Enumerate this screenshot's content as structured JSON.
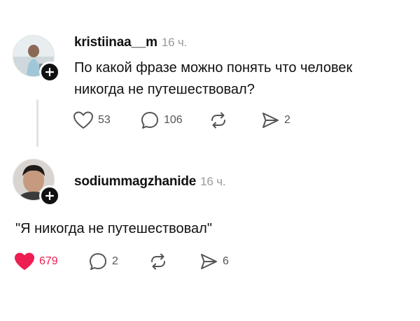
{
  "posts": [
    {
      "username": "kristiinaa__m",
      "time": "16 ч.",
      "text_lines": [
        "По какой фразе можно понять что человек",
        "никогда не путешествовал?"
      ],
      "likes": "53",
      "liked": false,
      "comments": "106",
      "shares": "2"
    },
    {
      "username": "sodiummagzhanide",
      "time": "16 ч.",
      "text_lines": [
        "\"Я никогда не путешествовал\""
      ],
      "likes": "679",
      "liked": true,
      "comments": "2",
      "shares": "6"
    }
  ],
  "icons": {
    "like": "heart-icon",
    "comment": "speech-bubble-icon",
    "repost": "repost-arrows-icon",
    "share": "send-arrow-icon",
    "follow": "plus-icon"
  },
  "colors": {
    "liked_heart": "#ee1d52",
    "liked_count": "#ee1d52",
    "icon_gray": "#555555",
    "time_gray": "#9a9a9a"
  }
}
